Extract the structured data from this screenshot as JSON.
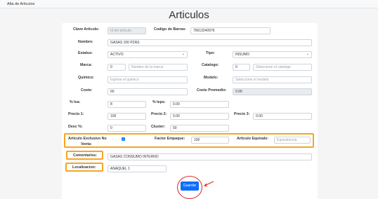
{
  "topbar": {
    "text": "Alta de Articulos"
  },
  "page": {
    "title": "Articulos"
  },
  "form": {
    "clave": {
      "label": "Clave Articulo:",
      "value": "Id del articulo"
    },
    "codigo": {
      "label": "Codigo de Barras:",
      "value": "75613240976"
    },
    "nombre": {
      "label": "Nombre:",
      "value": "GASAS 100 PZAS"
    },
    "estatus": {
      "label": "Estatus:",
      "value": "ACTIVO"
    },
    "tipo": {
      "label": "Tipo:",
      "value": "INSUMO"
    },
    "marca": {
      "label": "Marca:",
      "value": "0",
      "placeholder": "Nombre de la marca"
    },
    "catalogo": {
      "label": "Catalogo:",
      "value": "0",
      "placeholder": "Seleccione el catalogo"
    },
    "quimico": {
      "label": "Quimico:",
      "placeholder": "Ingrese el quimico"
    },
    "modelo": {
      "label": "Modelo:",
      "placeholder": "Seleccione el modelo"
    },
    "coste": {
      "label": "Coste:",
      "value": "60"
    },
    "coste_promedio": {
      "label": "Coste Promedio:",
      "value": "0.00"
    },
    "iva": {
      "label": "% Iva:",
      "value": "8"
    },
    "ieps": {
      "label": "% Ieps:",
      "value": "0.00"
    },
    "precio1": {
      "label": "Precio 1:",
      "value": "100"
    },
    "precio2": {
      "label": "Precio 2:",
      "value": "0.00"
    },
    "precio3": {
      "label": "Precio 3:",
      "value": "0.00"
    },
    "desc": {
      "label": "Desc %:",
      "value": "0"
    },
    "cluster": {
      "label": "Cluster:",
      "value": "50"
    },
    "exclusivo": {
      "label1": "Articulo Exclusivo No",
      "label2": "Venta:"
    },
    "factor": {
      "label": "Factor Empaque:",
      "value": "100"
    },
    "equivale": {
      "label": "Articulo Equivale:",
      "placeholder": "Equivalencia"
    },
    "comentarios": {
      "label": "Comentarios:",
      "value": "GASAS CONSUMO INTERNO"
    },
    "localizacion": {
      "label": "Localizacion:",
      "value": "ANAQUEL 1"
    }
  },
  "actions": {
    "save_label": "Guardar"
  }
}
